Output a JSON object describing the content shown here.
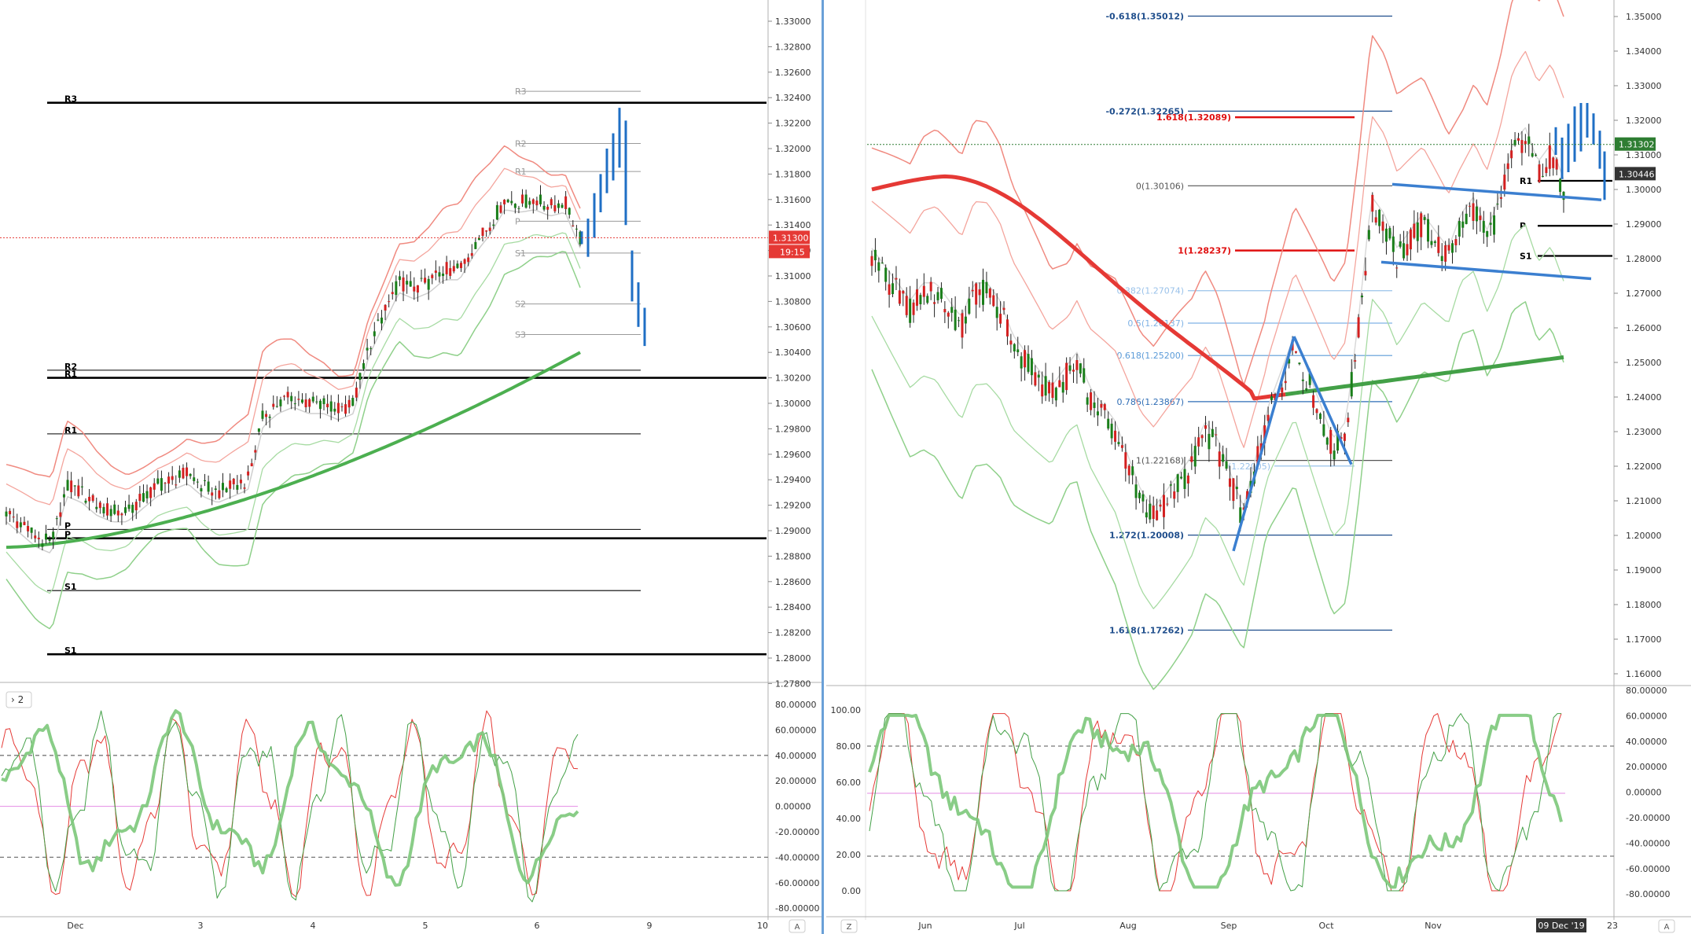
{
  "left": {
    "price_axis": [
      "1.33000",
      "1.32800",
      "1.32600",
      "1.32400",
      "1.32200",
      "1.32000",
      "1.31800",
      "1.31600",
      "1.31400",
      "1.31200",
      "1.31000",
      "1.30800",
      "1.30600",
      "1.30400",
      "1.30200",
      "1.30000",
      "1.29800",
      "1.29600",
      "1.29400",
      "1.29200",
      "1.29000",
      "1.28800",
      "1.28600",
      "1.28400",
      "1.28200",
      "1.28000",
      "1.27800"
    ],
    "current_price": "1.31300",
    "countdown": "19:15",
    "date_axis": [
      "Dec",
      "3",
      "4",
      "5",
      "6",
      "9",
      "10"
    ],
    "pivots": [
      {
        "label": "R3",
        "value": 1.3236
      },
      {
        "label": "R2",
        "value": 1.3026
      },
      {
        "label": "R1",
        "value": 1.302
      },
      {
        "label": "R1",
        "value": 1.2976
      },
      {
        "label": "P",
        "value": 1.2901
      },
      {
        "label": "P",
        "value": 1.2894
      },
      {
        "label": "S1",
        "value": 1.2853
      },
      {
        "label": "S1",
        "value": 1.2803
      }
    ],
    "weekly_pivots": [
      {
        "label": "R3",
        "value": 1.3245
      },
      {
        "label": "R2",
        "value": 1.3204
      },
      {
        "label": "R1",
        "value": 1.3182
      },
      {
        "label": "P",
        "value": 1.3143
      },
      {
        "label": "S1",
        "value": 1.3118
      },
      {
        "label": "S2",
        "value": 1.3078
      },
      {
        "label": "S3",
        "value": 1.3054
      }
    ],
    "osc_badge": "2",
    "osc_axis": [
      "80.00000",
      "60.00000",
      "40.00000",
      "20.00000",
      "0.00000",
      "-20.00000",
      "-40.00000",
      "-60.00000",
      "-80.00000"
    ],
    "axis_btn": "A"
  },
  "right": {
    "price_axis": [
      "1.35000",
      "1.34000",
      "1.33000",
      "1.32000",
      "1.31000",
      "1.30000",
      "1.29000",
      "1.28000",
      "1.27000",
      "1.26000",
      "1.25000",
      "1.24000",
      "1.23000",
      "1.22000",
      "1.21000",
      "1.20000",
      "1.19000",
      "1.18000",
      "1.17000",
      "1.16000"
    ],
    "price_tag_current": "1.31302",
    "price_tag_second": "1.30446",
    "date_axis": [
      "Jun",
      "Jul",
      "Aug",
      "Sep",
      "Oct",
      "Nov",
      "23"
    ],
    "date_tooltip": "09 Dec '19",
    "fib_levels": [
      {
        "label": "-0.618(1.35012)",
        "value": 1.35012,
        "color": "#1f4e8c"
      },
      {
        "label": "-0.272(1.32265)",
        "value": 1.32265,
        "color": "#1f4e8c"
      },
      {
        "label": "1.618(1.32089)",
        "value": 1.32089,
        "color": "#e01010"
      },
      {
        "label": "0(1.30106)",
        "value": 1.30106,
        "color": "#555555"
      },
      {
        "label": "1(1.28237)",
        "value": 1.28237,
        "color": "#e01010"
      },
      {
        "label": "0.382(1.27074)",
        "value": 1.27074,
        "color": "#9ac2ea"
      },
      {
        "label": "0.5(1.26137)",
        "value": 1.26137,
        "color": "#7fb2e5"
      },
      {
        "label": "0.618(1.25200)",
        "value": 1.252,
        "color": "#5b9bd8"
      },
      {
        "label": "0.786(1.23867)",
        "value": 1.23867,
        "color": "#2f6db5"
      },
      {
        "label": "1(1.22168)",
        "value": 1.22168,
        "color": "#555555"
      },
      {
        "label": "(1.22005)",
        "value": 1.22005,
        "color": "#9ac2ea"
      },
      {
        "label": "1.272(1.20008)",
        "value": 1.20008,
        "color": "#1f4e8c"
      },
      {
        "label": "1.618(1.17262)",
        "value": 1.17262,
        "color": "#1f4e8c"
      }
    ],
    "pivots": [
      {
        "label": "R1",
        "value": 1.3025
      },
      {
        "label": "P",
        "value": 1.2895
      },
      {
        "label": "S1",
        "value": 1.2808
      }
    ],
    "osc_left_axis": [
      "100.00",
      "80.00",
      "60.00",
      "40.00",
      "20.00",
      "0.00"
    ],
    "osc_right_axis": [
      "80.00000",
      "60.00000",
      "40.00000",
      "20.00000",
      "0.00000",
      "-20.00000",
      "-40.00000",
      "-60.00000",
      "-80.00000"
    ],
    "z_btn": "Z",
    "axis_btn": "A"
  },
  "chart_data": [
    {
      "type": "line",
      "title": "",
      "timeframe_span": [
        "Dec",
        "10"
      ],
      "ylim": [
        1.277,
        1.334
      ],
      "series": [
        {
          "values": [
            1.2915,
            1.2905,
            1.2895,
            1.289,
            1.2935,
            1.293,
            1.292,
            1.2915,
            1.2915,
            1.2925,
            1.2935,
            1.294,
            1.2945,
            1.2935,
            1.293,
            1.2935,
            1.294,
            1.299,
            1.3,
            1.3005,
            1.3,
            1.3,
            1.2995,
            1.3,
            1.3045,
            1.307,
            1.3095,
            1.309,
            1.3095,
            1.3105,
            1.3105,
            1.3125,
            1.314,
            1.316,
            1.3158,
            1.316,
            1.3155,
            1.3158,
            1.313
          ]
        }
      ]
    },
    {
      "type": "line",
      "title": "",
      "ylim": [
        1.155,
        1.355
      ],
      "series": [
        {
          "values": [
            1.28,
            1.275,
            1.27,
            1.265,
            1.27,
            1.27,
            1.265,
            1.26,
            1.27,
            1.27,
            1.265,
            1.255,
            1.25,
            1.245,
            1.24,
            1.245,
            1.25,
            1.24,
            1.235,
            1.23,
            1.22,
            1.21,
            1.205,
            1.21,
            1.215,
            1.22,
            1.23,
            1.225,
            1.215,
            1.205,
            1.22,
            1.235,
            1.245,
            1.255,
            1.245,
            1.235,
            1.225,
            1.23,
            1.26,
            1.295,
            1.29,
            1.28,
            1.285,
            1.29,
            1.285,
            1.28,
            1.29,
            1.295,
            1.285,
            1.295,
            1.31,
            1.315,
            1.305,
            1.31,
            1.3
          ]
        }
      ]
    }
  ]
}
